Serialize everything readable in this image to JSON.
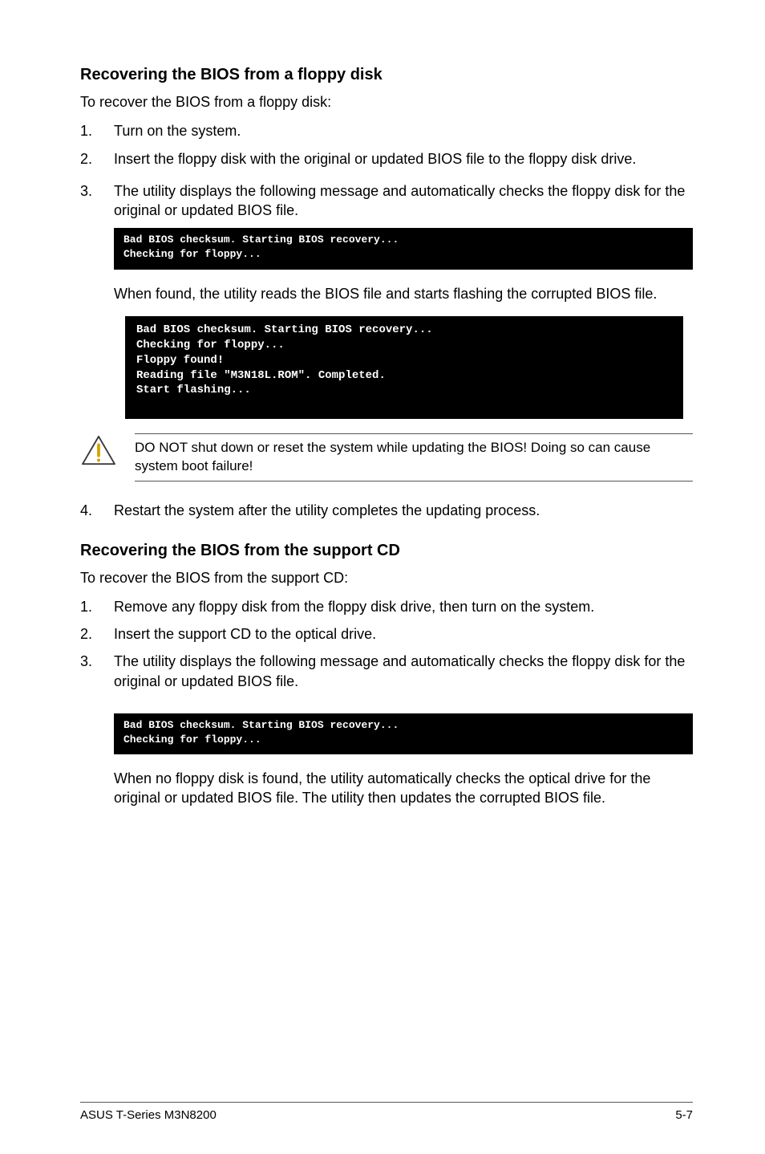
{
  "section1": {
    "heading": "Recovering the BIOS from a floppy disk",
    "intro": "To recover the BIOS from a floppy disk:",
    "steps": {
      "1": "Turn on the system.",
      "2": "Insert the floppy disk with the original or updated BIOS file to the floppy disk drive.",
      "3": "The utility displays the following message and automatically checks the floppy disk for the original or updated BIOS file.",
      "4": "Restart the system after the utility completes the updating process."
    },
    "terminal1": "Bad BIOS checksum. Starting BIOS recovery...\nChecking for floppy...",
    "after_terminal1": "When found, the utility reads the BIOS file and starts flashing the corrupted BIOS file.",
    "terminal2": "Bad BIOS checksum. Starting BIOS recovery...\nChecking for floppy...\nFloppy found!\nReading file \"M3N18L.ROM\". Completed.\nStart flashing...",
    "warning": "DO NOT shut down or reset the system while updating the BIOS! Doing so can cause system boot failure!"
  },
  "section2": {
    "heading": "Recovering the BIOS from the support CD",
    "intro": "To recover the BIOS from the support CD:",
    "steps": {
      "1": "Remove any floppy disk from the floppy disk drive, then turn on the system.",
      "2": "Insert the support CD to the optical drive.",
      "3": "The utility displays the following message and automatically checks the floppy disk for the original or updated BIOS file."
    },
    "terminal1": "Bad BIOS checksum. Starting BIOS recovery...\nChecking for floppy...",
    "after_terminal1": "When no floppy disk is found, the utility automatically checks the optical drive for the original or updated BIOS file. The utility then updates the corrupted BIOS file."
  },
  "footer": {
    "left": "ASUS T-Series M3N8200",
    "right": "5-7"
  }
}
